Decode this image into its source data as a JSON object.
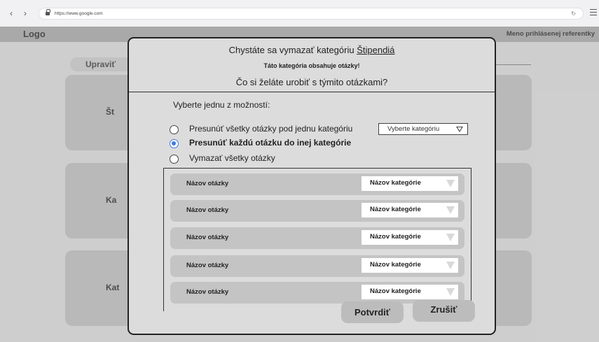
{
  "browser": {
    "url": "https://www.google.com",
    "back_icon": "chevron-left-icon",
    "forward_icon": "chevron-right-icon",
    "reload_icon": "reload-icon",
    "menu_icon": "hamburger-menu-icon"
  },
  "page": {
    "logo": "Logo",
    "user_name": "Meno prihlásenej referentky",
    "edit_tab": "Upraviť",
    "cards": [
      "Št",
      "Ka",
      "Kat"
    ]
  },
  "modal": {
    "title_prefix": "Chystáte sa vymazať kategóriu ",
    "title_category": "Štipendiá",
    "warning": "Táto kategória obsahuje otázky!",
    "question": "Čo si želáte urobiť s týmito otázkami?",
    "choose_label": "Vyberte jednu z možností:",
    "options": [
      {
        "label": "Presunúť všetky otázky pod jednu kategóriu",
        "checked": false
      },
      {
        "label": "Presunúť každú otázku do inej kategórie",
        "checked": true
      },
      {
        "label": "Vymazať všetky otázky",
        "checked": false
      }
    ],
    "category_select": "Vyberte kategóriu",
    "question_rows": [
      {
        "name": "Názov otázky",
        "category": "Názov kategórie"
      },
      {
        "name": "Názov otázky",
        "category": "Názov kategórie"
      },
      {
        "name": "Názov otázky",
        "category": "Názov kategórie"
      },
      {
        "name": "Názov otázky",
        "category": "Názov kategórie"
      },
      {
        "name": "Názov otázky",
        "category": "Názov kategórie"
      }
    ],
    "confirm_label": "Potvrdiť",
    "cancel_label": "Zrušiť"
  },
  "colors": {
    "accent": "#3d7be0",
    "modal_bg": "#dcdcdc",
    "row_bg": "#c4c4c4",
    "button_bg": "#bcbcbc"
  }
}
